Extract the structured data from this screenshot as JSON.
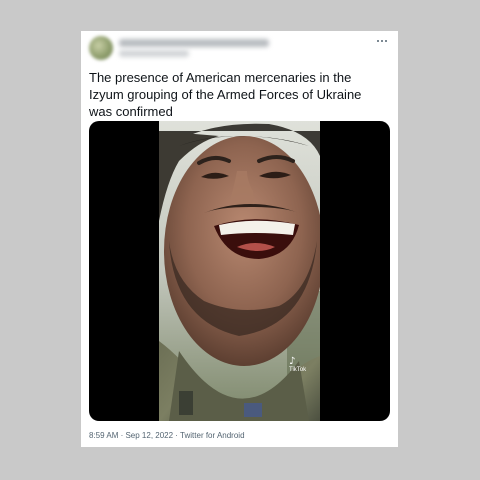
{
  "tweet": {
    "text": "The presence of American mercenaries in the Izyum grouping of the Armed Forces of Ukraine was confirmed",
    "menu_icon": "more-horizontal-icon",
    "time": "8:59 AM",
    "separator": " · ",
    "date": "Sep 12, 2022",
    "client": "Twitter for Android"
  },
  "media": {
    "watermark_brand": "TikTok",
    "watermark_icon": "tiktok-note-icon"
  },
  "colors": {
    "background": "#c9c9c9",
    "card": "#ffffff",
    "text": "#0f1419",
    "meta": "#536471",
    "video_letterbox": "#000000"
  }
}
